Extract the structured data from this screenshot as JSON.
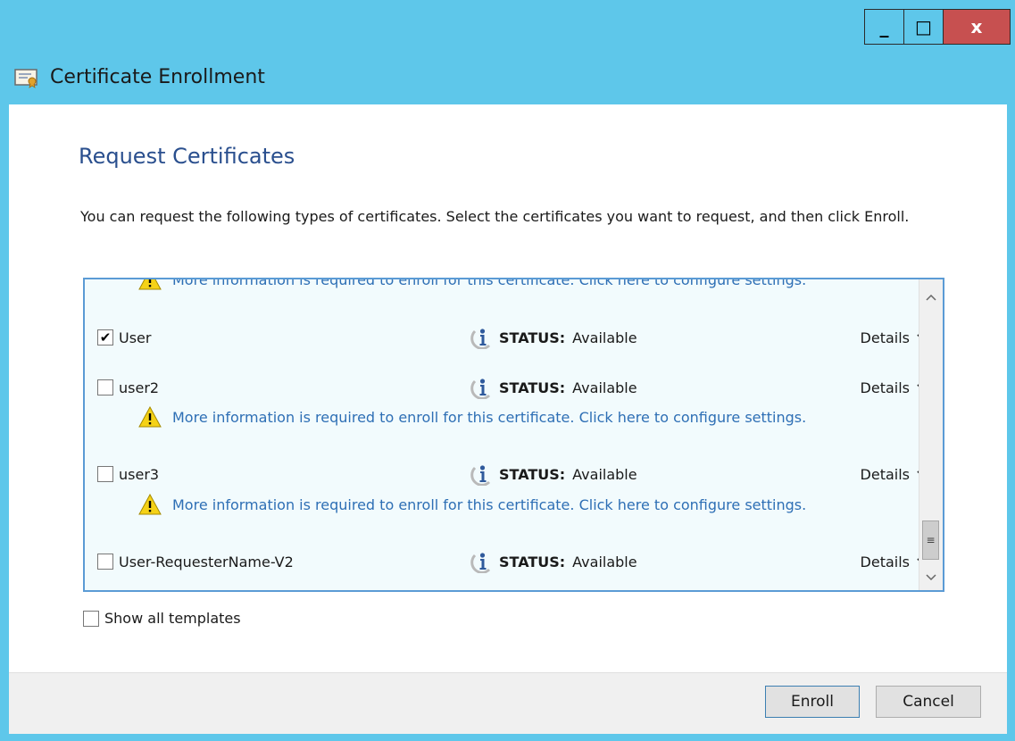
{
  "window": {
    "title": "Certificate Enrollment",
    "controls": {
      "minimize": "_",
      "maximize": "□",
      "close": "x"
    }
  },
  "page": {
    "heading": "Request Certificates",
    "description": "You can request the following types of certificates. Select the certificates you want to request, and then click Enroll."
  },
  "list": {
    "partial_warning": "More information is required to enroll for this certificate. Click here to configure settings.",
    "status_label": "STATUS:",
    "details_label": "Details",
    "items": [
      {
        "name": "User",
        "checked": true,
        "status": "Available",
        "warning": ""
      },
      {
        "name": "user2",
        "checked": false,
        "status": "Available",
        "warning": "More information is required to enroll for this certificate. Click here to configure settings."
      },
      {
        "name": "user3",
        "checked": false,
        "status": "Available",
        "warning": "More information is required to enroll for this certificate. Click here to configure settings."
      },
      {
        "name": "User-RequesterName-V2",
        "checked": false,
        "status": "Available",
        "warning": ""
      }
    ],
    "scrollbar": {
      "up": "^",
      "down": "v",
      "thumb": "≡"
    }
  },
  "show_all": {
    "label": "Show all templates",
    "checked": false
  },
  "buttons": {
    "enroll": "Enroll",
    "cancel": "Cancel"
  },
  "colors": {
    "titlebar": "#5ec7ea",
    "heading": "#2a4f8e",
    "link": "#2e6fb5",
    "list_border": "#5b9bd5"
  }
}
